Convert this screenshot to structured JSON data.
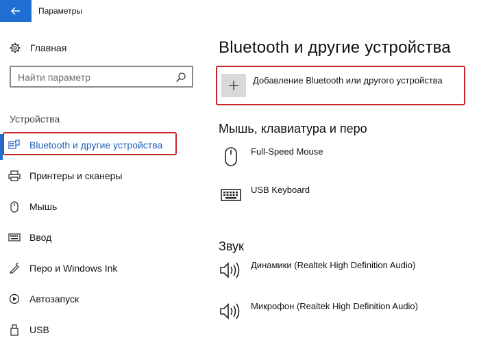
{
  "window": {
    "title": "Параметры"
  },
  "sidebar": {
    "home_label": "Главная",
    "search_placeholder": "Найти параметр",
    "section_label": "Устройства",
    "items": [
      {
        "label": "Bluetooth и другие устройства",
        "icon": "bluetooth-devices-icon",
        "active": true
      },
      {
        "label": "Принтеры и сканеры",
        "icon": "printer-icon"
      },
      {
        "label": "Мышь",
        "icon": "mouse-icon"
      },
      {
        "label": "Ввод",
        "icon": "keyboard-icon"
      },
      {
        "label": "Перо и Windows Ink",
        "icon": "pen-icon"
      },
      {
        "label": "Автозапуск",
        "icon": "autoplay-icon"
      },
      {
        "label": "USB",
        "icon": "usb-icon"
      }
    ]
  },
  "main": {
    "title": "Bluetooth и другие устройства",
    "add_device_label": "Добавление Bluetooth или другого устройства",
    "groups": [
      {
        "title": "Мышь, клавиатура и перо",
        "devices": [
          {
            "name": "Full-Speed Mouse",
            "icon": "mouse-icon"
          },
          {
            "name": "USB Keyboard",
            "icon": "keyboard-icon"
          }
        ]
      },
      {
        "title": "Звук",
        "devices": [
          {
            "name": "Динамики (Realtek High Definition Audio)",
            "icon": "speaker-icon"
          },
          {
            "name": "Микрофон (Realtek High Definition Audio)",
            "icon": "speaker-icon"
          }
        ]
      }
    ]
  },
  "colors": {
    "accent": "#1f6ed4",
    "highlight_red": "#c8262b",
    "active_text": "#1f5fbf"
  }
}
